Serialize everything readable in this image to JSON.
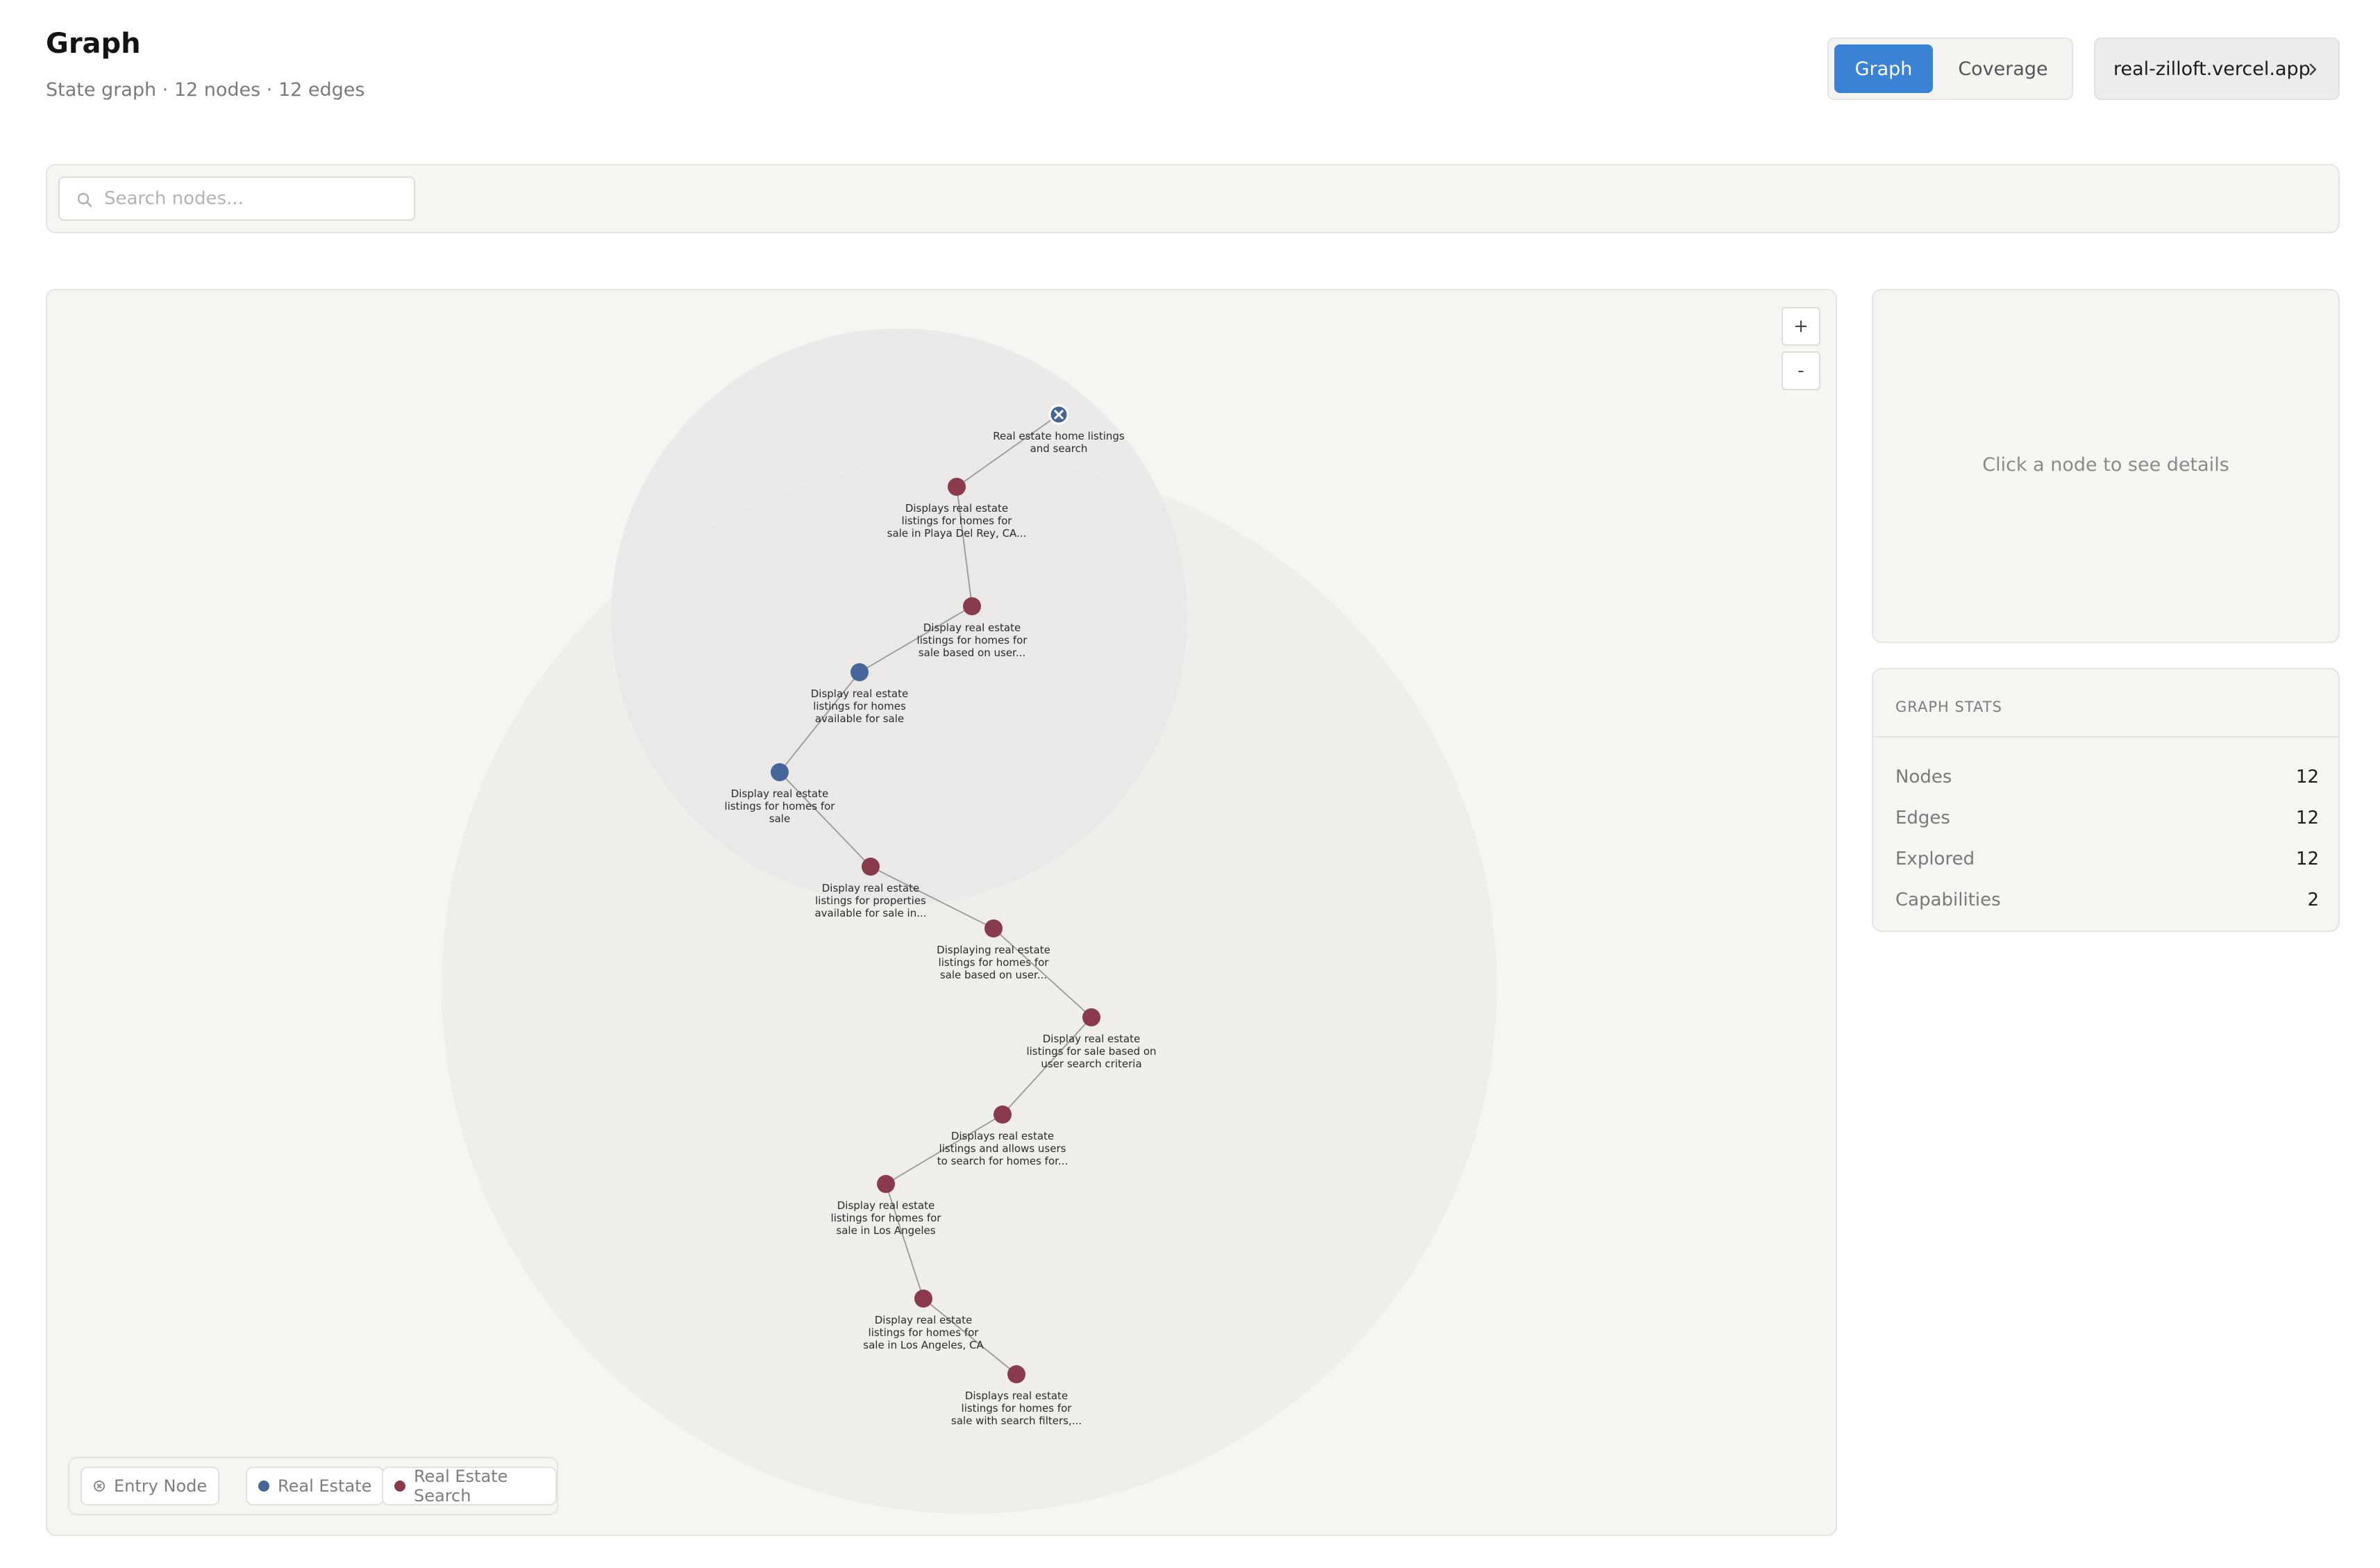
{
  "header": {
    "title": "Graph",
    "subtitle": "State graph · 12 nodes · 12 edges"
  },
  "view_toggle": {
    "graph_label": "Graph",
    "coverage_label": "Coverage",
    "active": "Graph"
  },
  "site": {
    "label": "real-zilloft.vercel.app",
    "icon": "chevron-right-icon"
  },
  "search": {
    "placeholder": "Search nodes...",
    "value": ""
  },
  "zoom": {
    "in_label": "+",
    "out_label": "-"
  },
  "graph": {
    "nodes": [
      {
        "id": "n1",
        "label": [
          "Real estate home listings",
          "and search"
        ],
        "category": "entry"
      },
      {
        "id": "n2",
        "label": [
          "Displays real estate",
          "listings for homes for",
          "sale in Playa Del Rey, CA..."
        ],
        "category": "Real Estate Search"
      },
      {
        "id": "n3",
        "label": [
          "Display real estate",
          "listings for homes for",
          "sale based on user..."
        ],
        "category": "Real Estate Search"
      },
      {
        "id": "n4",
        "label": [
          "Display real estate",
          "listings for homes",
          "available for sale"
        ],
        "category": "Real Estate"
      },
      {
        "id": "n5",
        "label": [
          "Display real estate",
          "listings for homes for",
          "sale"
        ],
        "category": "Real Estate"
      },
      {
        "id": "n6",
        "label": [
          "Display real estate",
          "listings for properties",
          "available for sale in..."
        ],
        "category": "Real Estate Search"
      },
      {
        "id": "n7",
        "label": [
          "Displaying real estate",
          "listings for homes for",
          "sale based on user..."
        ],
        "category": "Real Estate Search"
      },
      {
        "id": "n8",
        "label": [
          "Display real estate",
          "listings for sale based on",
          "user search criteria"
        ],
        "category": "Real Estate Search"
      },
      {
        "id": "n9",
        "label": [
          "Displays real estate",
          "listings and allows users",
          "to search for homes for..."
        ],
        "category": "Real Estate Search"
      },
      {
        "id": "n10",
        "label": [
          "Display real estate",
          "listings for homes for",
          "sale in Los Angeles"
        ],
        "category": "Real Estate Search"
      },
      {
        "id": "n11",
        "label": [
          "Display real estate",
          "listings for homes for",
          "sale in Los Angeles, CA"
        ],
        "category": "Real Estate Search"
      },
      {
        "id": "n12",
        "label": [
          "Displays real estate",
          "listings for homes for",
          "sale with search filters,..."
        ],
        "category": "Real Estate Search"
      }
    ],
    "edges": [
      [
        "n1",
        "n2"
      ],
      [
        "n2",
        "n3"
      ],
      [
        "n3",
        "n4"
      ],
      [
        "n4",
        "n5"
      ],
      [
        "n5",
        "n6"
      ],
      [
        "n6",
        "n7"
      ],
      [
        "n7",
        "n8"
      ],
      [
        "n8",
        "n9"
      ],
      [
        "n9",
        "n10"
      ],
      [
        "n10",
        "n11"
      ],
      [
        "n11",
        "n12"
      ]
    ],
    "colors": {
      "Real Estate": "#46669a",
      "Real Estate Search": "#8b3a4c",
      "entry": "#46669a",
      "edge": "#9a9894",
      "cluster": "#e9e8e8",
      "cluster_outer": "#f0eeeb"
    }
  },
  "legend": {
    "items": [
      {
        "label": "Entry Node",
        "icon": "entry-x-icon"
      },
      {
        "label": "Real Estate",
        "color": "#46669a"
      },
      {
        "label": "Real Estate Search",
        "color": "#8b3a4c"
      }
    ]
  },
  "details": {
    "empty_text": "Click a node to see details"
  },
  "stats": {
    "title": "GRAPH STATS",
    "rows": [
      {
        "label": "Nodes",
        "value": "12"
      },
      {
        "label": "Edges",
        "value": "12"
      },
      {
        "label": "Explored",
        "value": "12"
      },
      {
        "label": "Capabilities",
        "value": "2"
      }
    ]
  }
}
